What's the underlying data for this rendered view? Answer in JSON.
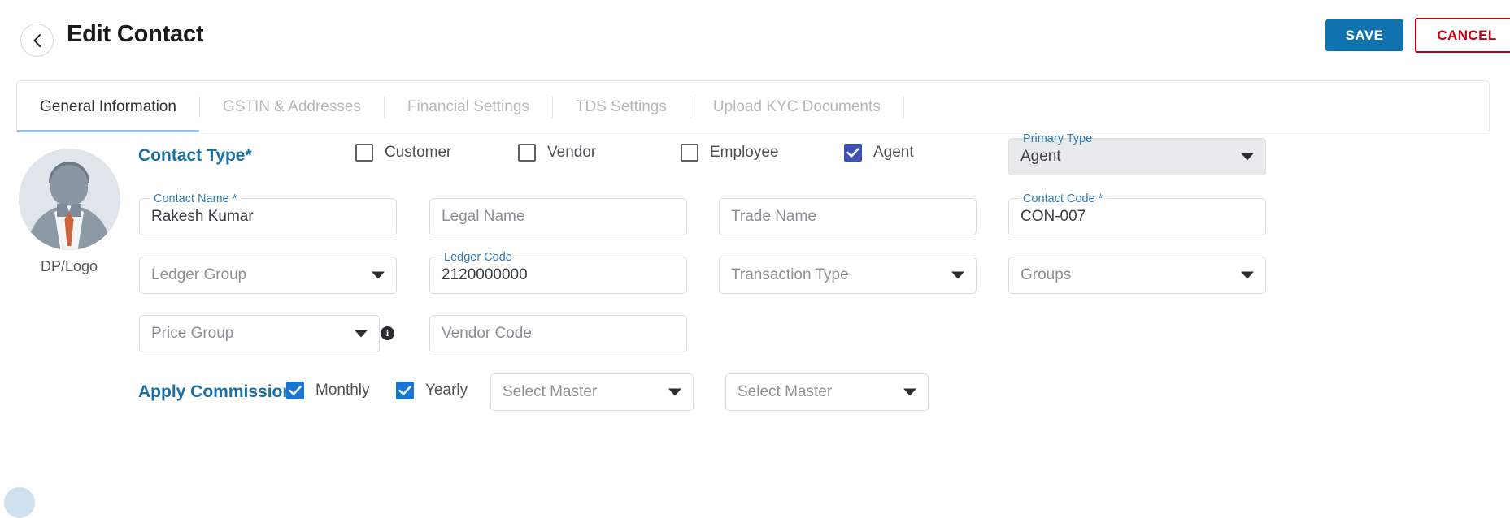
{
  "header": {
    "title": "Edit Contact",
    "back_icon": "chevron-left-icon",
    "save_label": "SAVE",
    "cancel_label": "CANCEL",
    "save_color": "#1073b0",
    "cancel_color": "#c3000f"
  },
  "tabs": [
    {
      "label": "General Information",
      "active": true
    },
    {
      "label": "GSTIN & Addresses",
      "active": false
    },
    {
      "label": "Financial Settings",
      "active": false
    },
    {
      "label": "TDS Settings",
      "active": false
    },
    {
      "label": "Upload KYC Documents",
      "active": false
    }
  ],
  "avatar": {
    "caption": "DP/Logo",
    "icon": "user-avatar-icon"
  },
  "contact_type": {
    "label": "Contact Type*",
    "label_color": "#1a6fa3",
    "options": [
      {
        "label": "Customer",
        "checked": false
      },
      {
        "label": "Vendor",
        "checked": false
      },
      {
        "label": "Employee",
        "checked": false
      },
      {
        "label": "Agent",
        "checked": true
      }
    ]
  },
  "primary_type": {
    "label": "Primary Type",
    "value": "Agent",
    "disabled": true,
    "icon": "chevron-down-icon"
  },
  "fields": {
    "contact_name": {
      "label": "Contact Name *",
      "value": "Rakesh Kumar",
      "placeholder": ""
    },
    "legal_name": {
      "label": "",
      "value": "",
      "placeholder": "Legal Name"
    },
    "trade_name": {
      "label": "",
      "value": "",
      "placeholder": "Trade Name"
    },
    "contact_code": {
      "label": "Contact Code *",
      "value": "CON-007",
      "placeholder": ""
    },
    "ledger_group": {
      "label": "",
      "value": "",
      "placeholder": "Ledger Group",
      "icon": "chevron-down-icon"
    },
    "ledger_code": {
      "label": "Ledger Code",
      "value": "2120000000",
      "placeholder": ""
    },
    "transaction_type": {
      "label": "",
      "value": "",
      "placeholder": "Transaction Type",
      "icon": "chevron-down-icon"
    },
    "groups": {
      "label": "",
      "value": "",
      "placeholder": "Groups",
      "icon": "chevron-down-icon"
    },
    "price_group": {
      "label": "",
      "value": "",
      "placeholder": "Price Group",
      "icon": "chevron-down-icon",
      "info_icon": "info-icon"
    },
    "vendor_code": {
      "label": "",
      "value": "",
      "placeholder": "Vendor Code"
    }
  },
  "apply_commission": {
    "label": "Apply Commission*",
    "label_color": "#1a6fa3",
    "options": [
      {
        "label": "Monthly",
        "checked": true
      },
      {
        "label": "Yearly",
        "checked": true
      }
    ],
    "master_1": {
      "placeholder": "Select Master",
      "icon": "chevron-down-icon"
    },
    "master_2": {
      "placeholder": "Select Master",
      "icon": "chevron-down-icon"
    }
  }
}
